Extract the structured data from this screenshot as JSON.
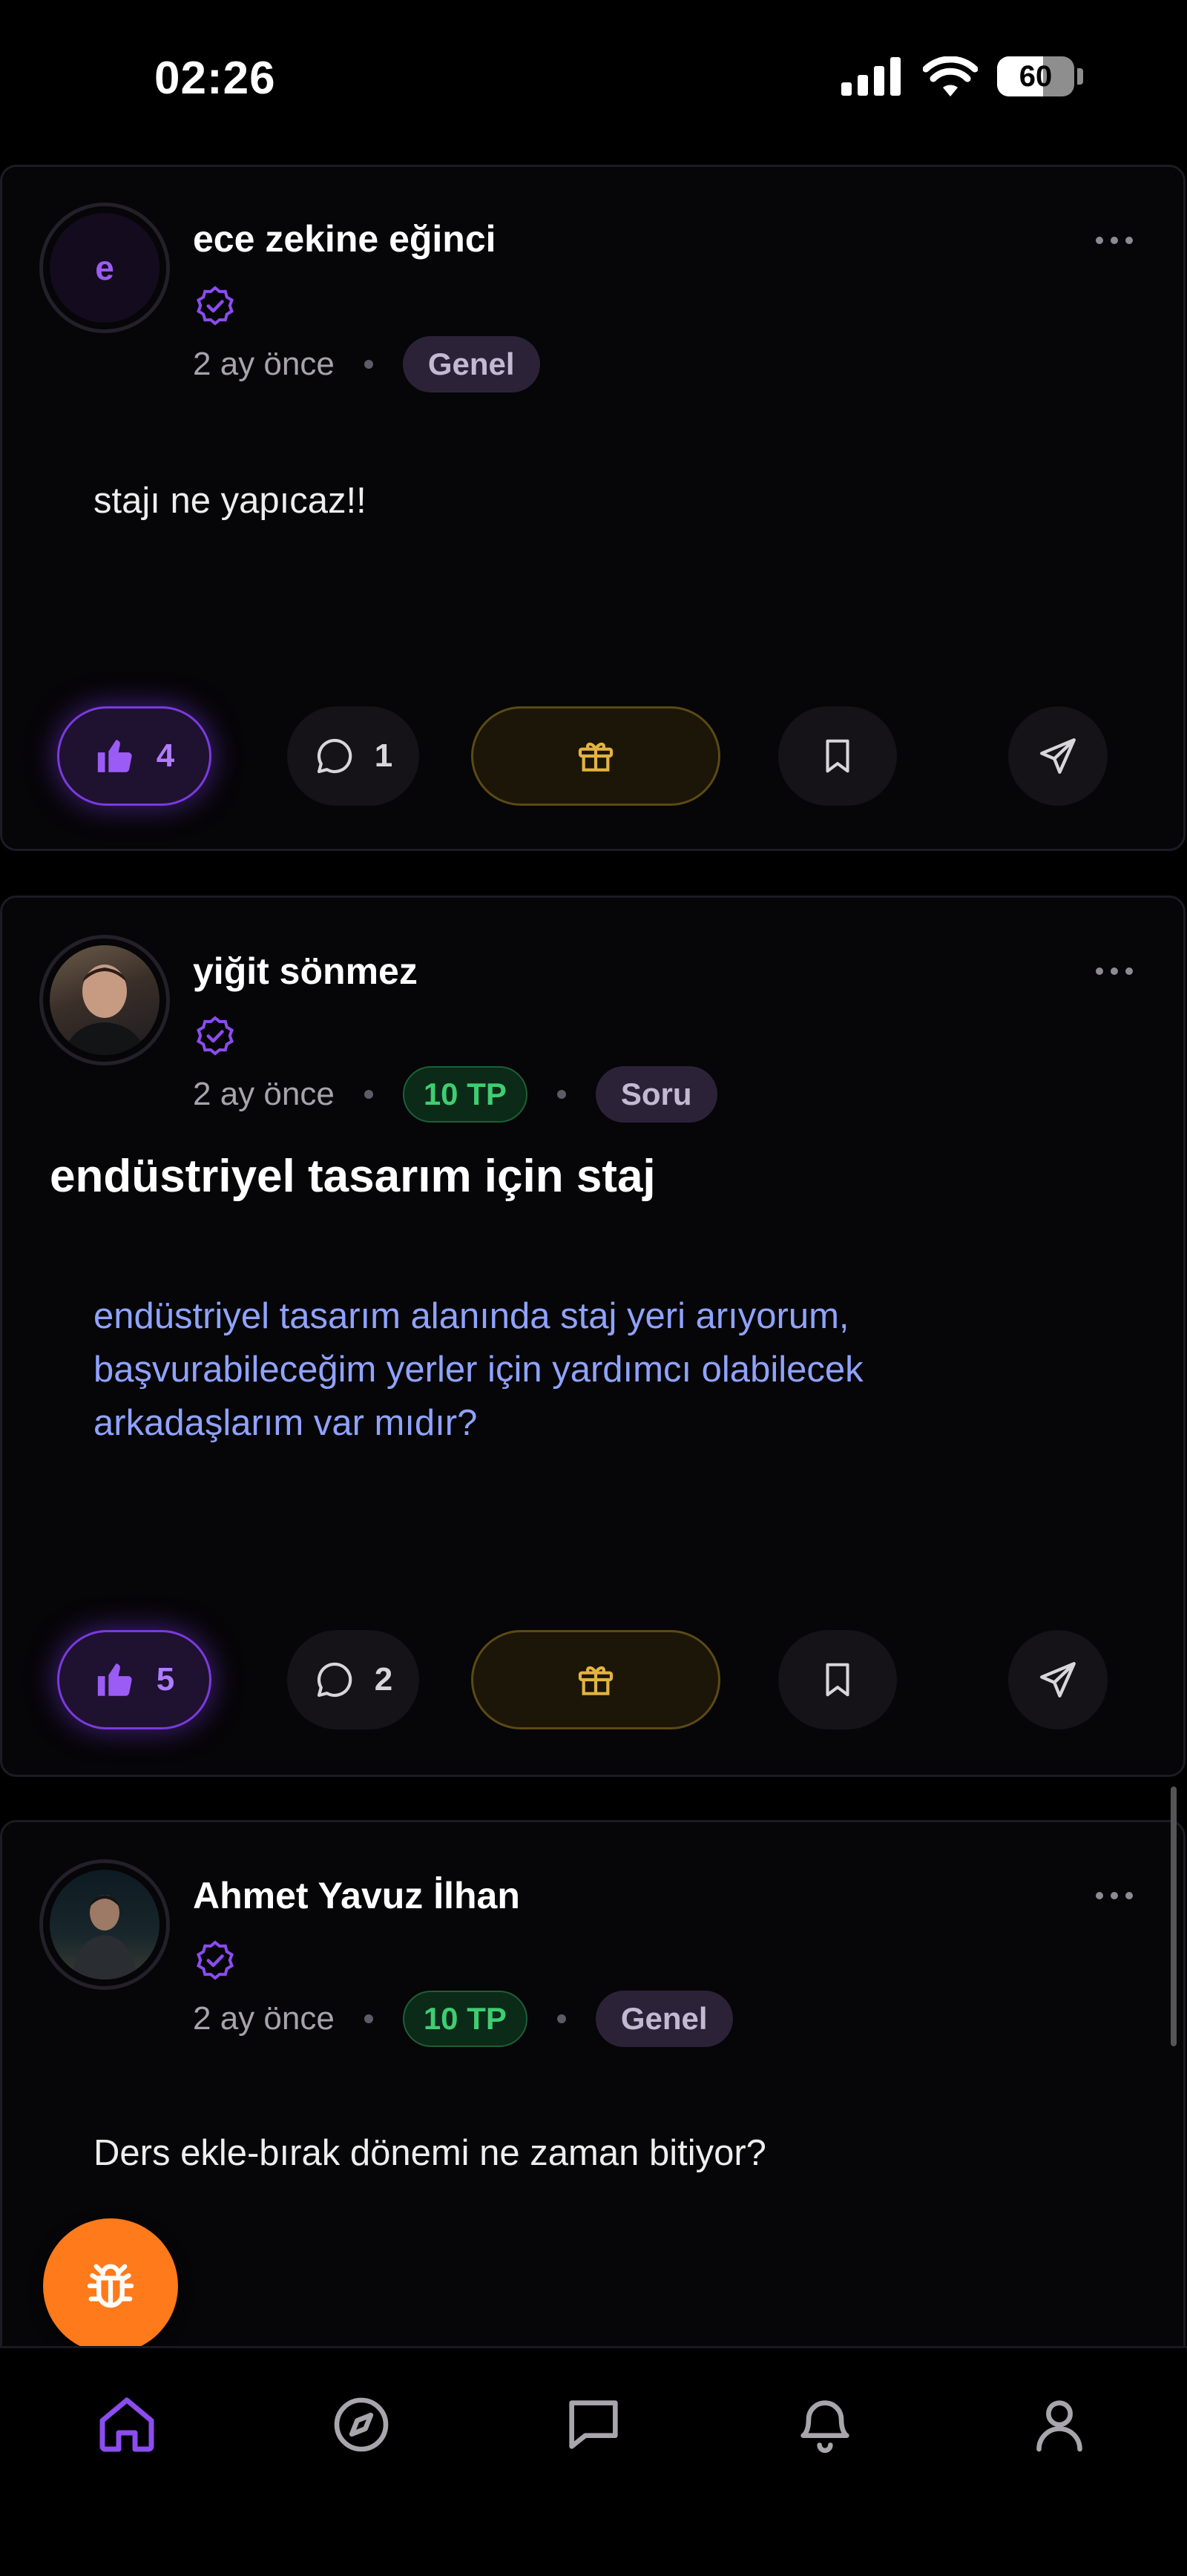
{
  "status_bar": {
    "time": "02:26",
    "battery": "60",
    "battery_level": 0.6
  },
  "posts": [
    {
      "avatar_letter": "e",
      "author": "ece zekine eğinci",
      "time": "2 ay önce",
      "category": "Genel",
      "body": "stajı ne yapıcaz!!",
      "likes": "4",
      "comments": "1"
    },
    {
      "author": "yiğit sönmez",
      "time": "2 ay önce",
      "points": "10 TP",
      "category": "Soru",
      "title": "endüstriyel tasarım için staj",
      "body_lines": [
        "endüstriyel tasarım alanında staj yeri arıyorum,",
        "başvurabileceğim yerler için yardımcı olabilecek",
        "arkadaşlarım var mıdır?"
      ],
      "likes": "5",
      "comments": "2"
    },
    {
      "author": "Ahmet Yavuz İlhan",
      "time": "2 ay önce",
      "points": "10 TP",
      "category": "Genel",
      "body": "Ders ekle-bırak dönemi ne zaman bitiyor?"
    }
  ],
  "colors": {
    "accent_purple": "#7c3aed",
    "tp_green": "#3fcd72",
    "gift_gold": "#e3b341",
    "bug_orange": "#ff7a1a",
    "link_blue": "#8fa3ff"
  },
  "icons": {
    "like": "thumbs-up-icon",
    "comment": "comment-icon",
    "gift": "gift-icon",
    "save": "bookmark-icon",
    "share": "send-icon",
    "bug": "bug-icon",
    "nav": [
      "home-icon",
      "compass-icon",
      "chat-icon",
      "bell-icon",
      "profile-icon"
    ]
  }
}
